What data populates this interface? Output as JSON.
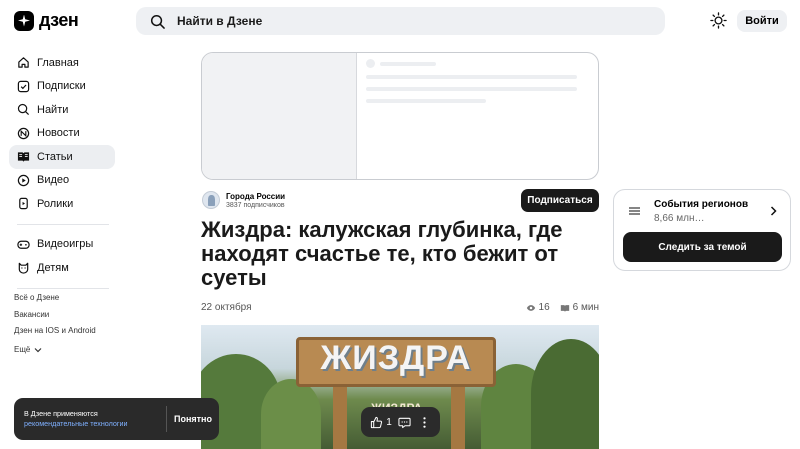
{
  "header": {
    "logo_text": "дзен",
    "search_placeholder": "Найти в Дзене",
    "login_label": "Войти"
  },
  "sidebar": {
    "items": [
      {
        "label": "Главная",
        "icon": "home-icon"
      },
      {
        "label": "Подписки",
        "icon": "subscriptions-icon"
      },
      {
        "label": "Найти",
        "icon": "search-icon"
      },
      {
        "label": "Новости",
        "icon": "news-icon"
      },
      {
        "label": "Статьи",
        "icon": "articles-icon",
        "active": true
      },
      {
        "label": "Видео",
        "icon": "video-icon"
      },
      {
        "label": "Ролики",
        "icon": "shorts-icon"
      }
    ],
    "items2": [
      {
        "label": "Видеоигры",
        "icon": "gamepad-icon"
      },
      {
        "label": "Детям",
        "icon": "kids-icon"
      }
    ],
    "footer_links": [
      "Всё о Дзене",
      "Вакансии",
      "Дзен на IOS и Android",
      "Ещё"
    ]
  },
  "article": {
    "channel_name": "Города России",
    "channel_subs": "3837 подписчиков",
    "subscribe_label": "Подписаться",
    "title": "Жиздра: калужская глубинка, где находят счастье те, кто бежит от суеты",
    "date": "22 октября",
    "views": "16",
    "read_time": "6 мин",
    "photo_sign": "ЖИЗДРА",
    "photo_sub": "ЖИЗДРА"
  },
  "reactions": {
    "likes": "1"
  },
  "widget": {
    "title": "События регионов",
    "subtitle": "8,66 млн…",
    "follow_label": "Следить за темой"
  },
  "notice": {
    "text": "В Дзене применяются",
    "link": "рекомендательные технологии",
    "button": "Понятно"
  }
}
